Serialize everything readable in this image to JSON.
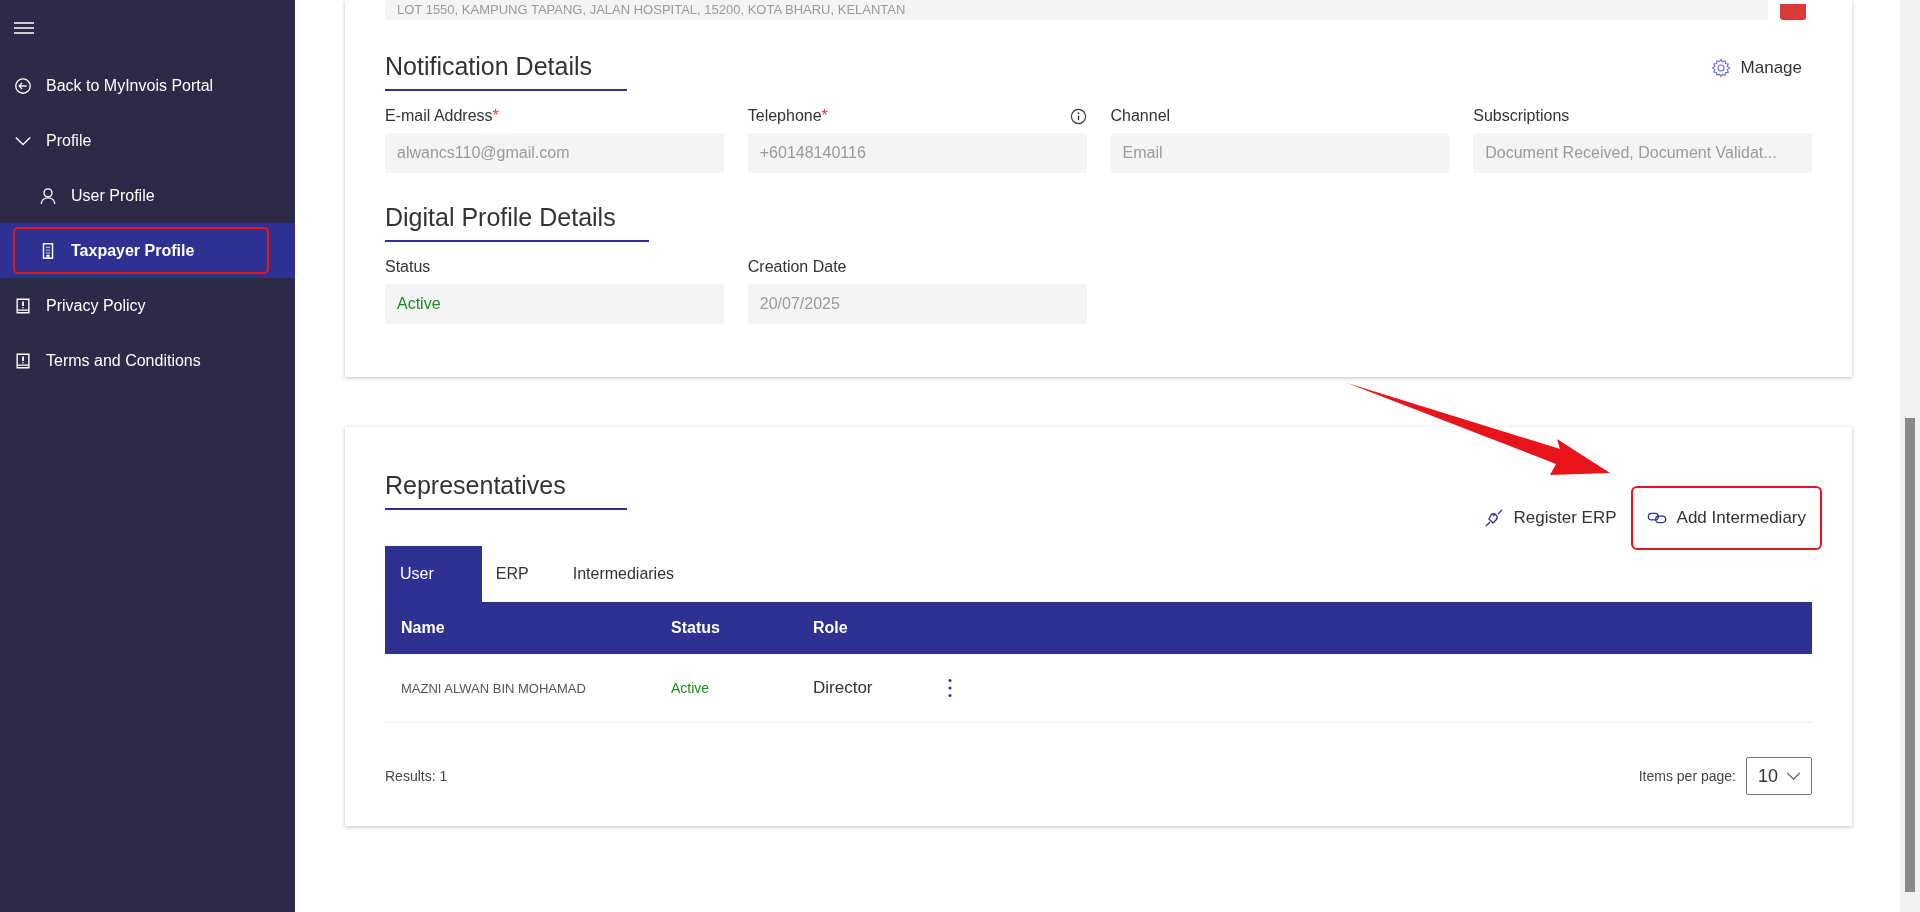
{
  "sidebar": {
    "items": [
      {
        "label": "Back to MyInvois Portal",
        "selected": false
      },
      {
        "label": "Profile",
        "selected": false,
        "expanded": true,
        "children": [
          {
            "label": "User Profile",
            "selected": false
          },
          {
            "label": "Taxpayer Profile",
            "selected": true
          }
        ]
      },
      {
        "label": "Privacy Policy",
        "selected": false
      },
      {
        "label": "Terms and Conditions",
        "selected": false
      }
    ]
  },
  "address_field": {
    "value": "LOT 1550, KAMPUNG TAPANG, JALAN HOSPITAL, 15200, KOTA BHARU, KELANTAN"
  },
  "notification_details": {
    "title": "Notification Details",
    "manage_button": "Manage",
    "fields": [
      {
        "label": "E-mail Address",
        "required_mark": "*",
        "info": false,
        "kind": "text",
        "value": "alwancs110@gmail.com"
      },
      {
        "label": "Telephone",
        "required_mark": "*",
        "info": true,
        "kind": "text",
        "value": "+60148140116"
      },
      {
        "label": "Channel",
        "info": false,
        "kind": "text",
        "value": "Email"
      },
      {
        "label": "Subscriptions",
        "info": false,
        "kind": "text",
        "value": "Document Received, Document Validat..."
      }
    ]
  },
  "digital_profile_details": {
    "title": "Digital Profile Details",
    "fields": [
      {
        "label": "Status",
        "info": false,
        "kind": "status",
        "value": "Active"
      },
      {
        "label": "Creation Date",
        "info": false,
        "kind": "text",
        "value": "20/07/2025"
      }
    ]
  },
  "representatives": {
    "title": "Representatives",
    "register_erp_button": "Register ERP",
    "add_intermediary_button": "Add Intermediary",
    "tabs": [
      {
        "label": "User",
        "selected": true
      },
      {
        "label": "ERP",
        "selected": false
      },
      {
        "label": "Intermediaries",
        "selected": false
      }
    ],
    "table": {
      "columns": [
        "Name",
        "Status",
        "Role"
      ],
      "rows": [
        {
          "name": "MAZNI ALWAN BIN MOHAMAD",
          "status": "Active",
          "role": "Director"
        }
      ]
    },
    "results": "Results: 1",
    "items_per_page_label": "Items per page:",
    "items_per_page": "10"
  }
}
